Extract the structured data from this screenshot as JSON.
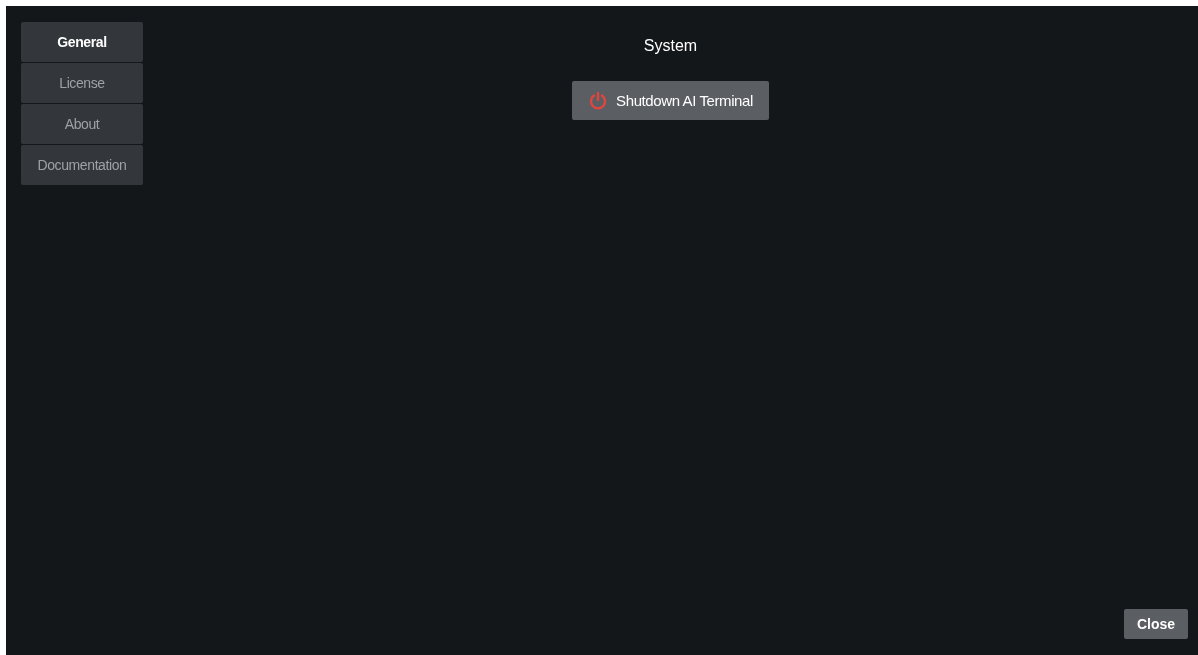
{
  "tabs": [
    {
      "label": "General",
      "selected": true
    },
    {
      "label": "License",
      "selected": false
    },
    {
      "label": "About",
      "selected": false
    },
    {
      "label": "Documentation",
      "selected": false
    }
  ],
  "section": {
    "title": "System"
  },
  "shutdown_button": {
    "label": "Shutdown AI Terminal"
  },
  "close_button": {
    "label": "Close"
  }
}
